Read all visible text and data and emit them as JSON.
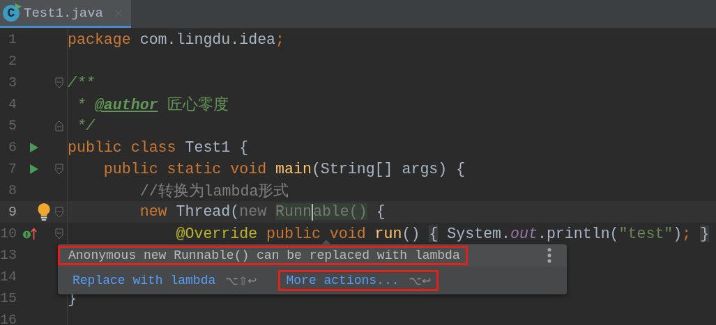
{
  "tabs": [
    {
      "label": "Test1.java",
      "icon_letter": "C",
      "selected": true
    }
  ],
  "lines": [
    {
      "number": "1",
      "tokens": [
        {
          "kind": "keyword",
          "text": "package"
        },
        {
          "kind": "plain",
          "text": " com.lingdu.idea"
        },
        {
          "kind": "keyword",
          "text": ";"
        }
      ]
    },
    {
      "number": "2"
    },
    {
      "number": "3",
      "fold": {
        "kind": "open"
      },
      "tokens": [
        {
          "kind": "doc",
          "text": "/**"
        }
      ]
    },
    {
      "number": "4",
      "tokens": [
        {
          "kind": "doc",
          "text": " * "
        },
        {
          "kind": "doctag",
          "text": "@author"
        },
        {
          "kind": "doc-plain",
          "text": " 匠心零度"
        }
      ]
    },
    {
      "number": "5",
      "fold": {
        "kind": "close"
      },
      "tokens": [
        {
          "kind": "doc",
          "text": " */"
        }
      ]
    },
    {
      "number": "6",
      "gutter": {
        "kind": "run"
      },
      "tokens": [
        {
          "kind": "keyword",
          "text": "public class "
        },
        {
          "kind": "plain",
          "text": "Test1 {"
        }
      ]
    },
    {
      "number": "7",
      "gutter": {
        "kind": "run"
      },
      "fold": {
        "kind": "open"
      },
      "tokens": [
        {
          "kind": "keyword",
          "text": "    public static void "
        },
        {
          "kind": "method",
          "text": "main"
        },
        {
          "kind": "plain",
          "text": "(String[] args) {"
        }
      ]
    },
    {
      "number": "8",
      "tokens": [
        {
          "kind": "comment",
          "text": "        //转换为lambda形式"
        }
      ]
    },
    {
      "number": "9",
      "current": true,
      "gutter": {
        "kind": "bulb"
      },
      "fold": {
        "kind": "open"
      },
      "tokens": [
        {
          "kind": "keyword",
          "text": "        new "
        },
        {
          "kind": "plain",
          "text": "Thread("
        },
        {
          "kind": "hint",
          "text": "new "
        },
        {
          "kind": "hint-hl",
          "text": "Runn",
          "caret": true
        },
        {
          "kind": "hint-hl",
          "text": "able()"
        },
        {
          "kind": "plain",
          "text": " {"
        }
      ]
    },
    {
      "number": "10",
      "gutter": {
        "kind": "implements"
      },
      "fold": {
        "kind": "open"
      },
      "tokens": [
        {
          "kind": "annotation",
          "text": "            @Override"
        },
        {
          "kind": "keyword",
          "text": " public void "
        },
        {
          "kind": "method",
          "text": "run"
        },
        {
          "kind": "plain",
          "text": "() "
        },
        {
          "kind": "folded",
          "text": "{"
        },
        {
          "kind": "plain",
          "text": " System."
        },
        {
          "kind": "static",
          "text": "out"
        },
        {
          "kind": "plain",
          "text": ".println("
        },
        {
          "kind": "string",
          "text": "\"test\""
        },
        {
          "kind": "plain",
          "text": ")"
        },
        {
          "kind": "keyword",
          "text": "; "
        },
        {
          "kind": "folded",
          "text": "}"
        }
      ]
    },
    {
      "number": "13"
    },
    {
      "number": "14"
    },
    {
      "number": "15",
      "tokens": [
        {
          "kind": "plain",
          "text": "}"
        }
      ]
    },
    {
      "number": "16"
    }
  ],
  "popup": {
    "message": "Anonymous new Runnable() can be replaced with lambda",
    "message_highlighted": true,
    "actions": [
      {
        "label": "Replace with lambda",
        "shortcut": "⌥⇧↩",
        "highlighted": false
      },
      {
        "label": "More actions...",
        "shortcut": "⌥↩",
        "highlighted": true
      }
    ]
  }
}
